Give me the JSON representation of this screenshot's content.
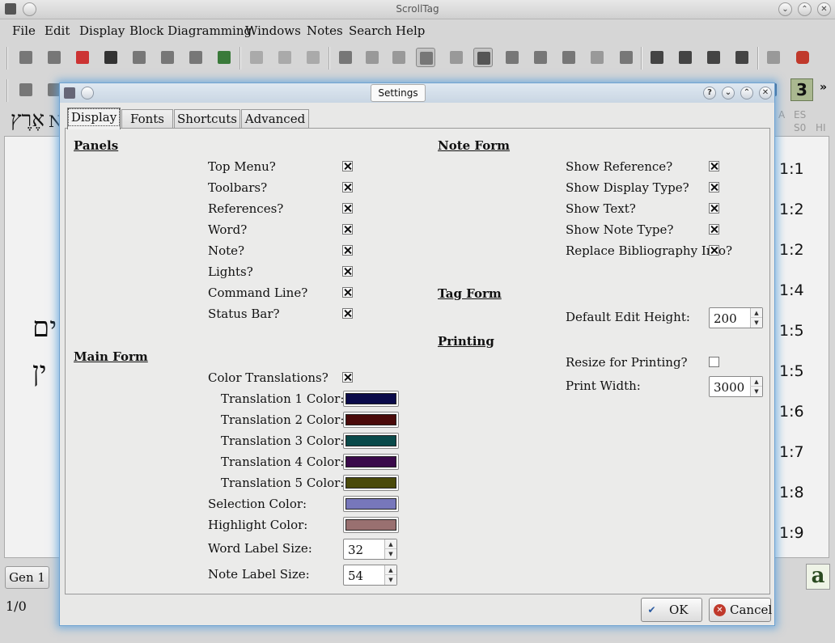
{
  "app": {
    "title": "ScrollTag"
  },
  "menu": [
    "File",
    "Edit",
    "Display",
    "Block Diagramming",
    "Windows",
    "Notes",
    "Search",
    "Help"
  ],
  "main": {
    "hebrew_top": "אֶרֶץ",
    "hebrew_top_letter": "N",
    "hebrew_mid1": "ים",
    "hebrew_mid2": "ין",
    "verses": [
      "1:1",
      "1:2",
      "1:2",
      "1:4",
      "1:5",
      "1:5",
      "1:6",
      "1:7",
      "1:8",
      "1:9"
    ],
    "lang_codes": [
      "A",
      "ES",
      "S0",
      "HI"
    ],
    "toolbar_number": "3",
    "more_glyph": "»",
    "gen_button": "Gen 1",
    "a_button": "a",
    "position_label": "1/0"
  },
  "dialog": {
    "title": "Settings",
    "title_buttons": [
      "?",
      "⌄",
      "⌃",
      "✕"
    ],
    "tabs": [
      "Display",
      "Fonts",
      "Shortcuts",
      "Advanced"
    ],
    "panels": {
      "header": "Panels",
      "items": [
        {
          "label": "Top Menu?",
          "checked": true
        },
        {
          "label": "Toolbars?",
          "checked": true
        },
        {
          "label": "References?",
          "checked": true
        },
        {
          "label": "Word?",
          "checked": true
        },
        {
          "label": "Note?",
          "checked": true
        },
        {
          "label": "Lights?",
          "checked": true
        },
        {
          "label": "Command Line?",
          "checked": true
        },
        {
          "label": "Status Bar?",
          "checked": true
        }
      ]
    },
    "main_form": {
      "header": "Main Form",
      "color_translations_label": "Color Translations?",
      "color_translations_checked": true,
      "translation_colors": [
        {
          "label": "Translation 1 Color:",
          "color": "#0a0a4a"
        },
        {
          "label": "Translation 2 Color:",
          "color": "#4a0a0a"
        },
        {
          "label": "Translation 3 Color:",
          "color": "#0a4a4a"
        },
        {
          "label": "Translation 4 Color:",
          "color": "#3a0a4a"
        },
        {
          "label": "Translation 5 Color:",
          "color": "#4a4a0a"
        }
      ],
      "selection_color_label": "Selection Color:",
      "selection_color": "#7777bb",
      "highlight_color_label": "Highlight Color:",
      "highlight_color": "#997070",
      "word_label_size_label": "Word Label Size:",
      "word_label_size": "32",
      "note_label_size_label": "Note Label Size:",
      "note_label_size": "54"
    },
    "note_form": {
      "header": "Note Form",
      "items": [
        {
          "label": "Show Reference?",
          "checked": true
        },
        {
          "label": "Show Display Type?",
          "checked": true
        },
        {
          "label": "Show Text?",
          "checked": true
        },
        {
          "label": "Show Note Type?",
          "checked": true
        },
        {
          "label": "Replace Bibliography Info?",
          "checked": true
        }
      ]
    },
    "tag_form": {
      "header": "Tag Form",
      "default_edit_height_label": "Default Edit Height:",
      "default_edit_height": "200"
    },
    "printing": {
      "header": "Printing",
      "resize_label": "Resize for Printing?",
      "resize_checked": false,
      "print_width_label": "Print Width:",
      "print_width": "3000"
    },
    "buttons": {
      "ok": "OK",
      "cancel": "Cancel"
    }
  }
}
